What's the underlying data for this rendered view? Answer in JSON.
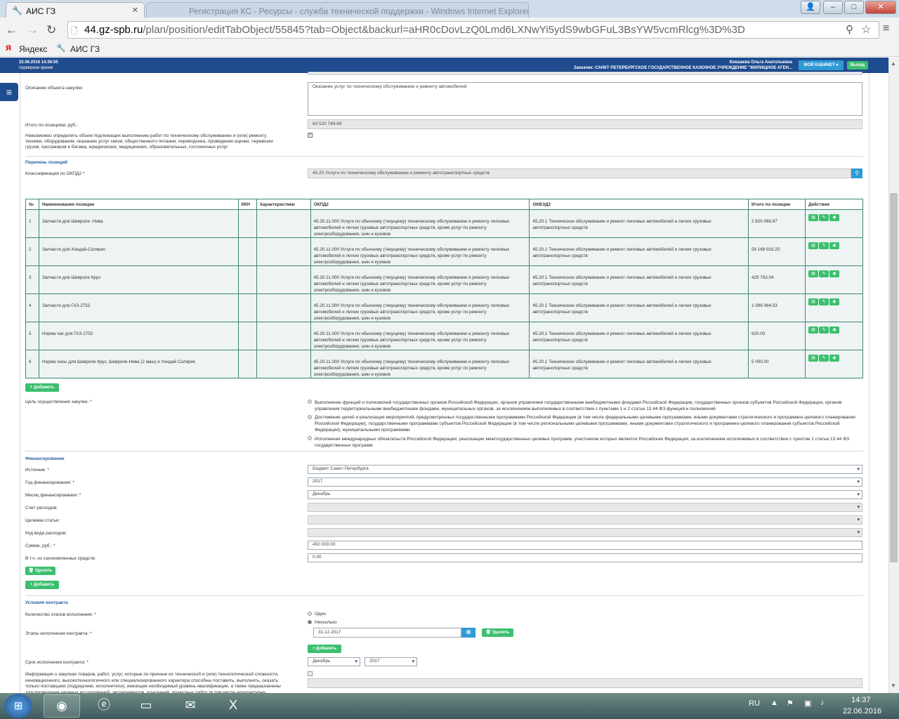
{
  "browser": {
    "tab_active": "АИС ГЗ",
    "tab_inactive": "Регистрация КС - Ресурсы - служба технической поддержки - Windows Internet Explorer",
    "url_host": "44.gz-spb.ru",
    "url_path": "/plan/position/editTabObject/55845?tab=Object&backurl=aHR0cDovLzQ0Lmd6LXNwYi5ydS9wbGFuL3BsYW5vcmRlcg%3D%3D",
    "bookmarks": [
      "Яндекс",
      "АИС ГЗ"
    ],
    "minimize": "–",
    "maximize": "□",
    "close": "✕",
    "newtab": "+"
  },
  "header": {
    "date": "22.06.2016 14:36:55",
    "time_label": "серверное время",
    "user": "Кокшаева Ольга Анатольевна",
    "customer": "Заказчик: САНКТ-ПЕТЕРБУРГСКОЕ ГОСУДАРСТВЕННОЕ КАЗЕННОЕ УЧРЕЖДЕНИЕ \"ЖИЛИЩНОЕ АГЕН...",
    "cabinet": "МОЙ КАБИНЕТ ▾",
    "exit": "Выход"
  },
  "form": {
    "desc_label": "Описание объекта закупки:",
    "desc_value": "Оказание услуг по техническому обслуживанию и ремонту автомобилей",
    "total_label": "Итого по позициям, руб.:",
    "total_value": "63 520 749,69",
    "impossible_label": "Невозможно определить объем подлежащих выполнению работ по техническому обслуживанию и (или) ремонту техники, оборудования, оказанию услуг связи, общественного питания, переводчика, проведения оценки, перевозки грузов, пассажиров и багажа, юридических, медицинских, образовательных, гостиничных услуг",
    "positions_title": "Перечень позиций",
    "okpd_label": "Классификация по ОКПД2 *",
    "okpd_value": "45.20 Услуги по техническому обслуживанию и ремонту автотранспортных средств",
    "add_label": "+ Добавить",
    "purpose_label": "Цель осуществления закупки: *",
    "purposes": [
      "Выполнение функций и полномочий государственных органов Российской Федерации, органов управления государственными внебюджетными фондами Российской Федерации, государственных органов субъектов Российской Федерации, органов управления территориальными внебюджетными фондами, муниципальных органов, за исключением выполняемых в соответствии с пунктами 1 и 2 статьи 13 44 ФЗ функций и полномочий",
      "Достижение целей и реализация мероприятий, предусмотренных государственными программами Российской Федерации (в том числе федеральными целевыми программами, иными документами стратегического и программно-целевого планирования Российской Федерации), государственными программами субъектов Российской Федерации (в том числе региональными целевыми программами, иными документами стратегического и программно-целевого планирования субъектов Российской Федерации), муниципальными программами",
      "Исполнение международных обязательств Российской Федерации, реализации межгосударственных целевых программ, участником которых является Российская Федерация, за исключением исполняемых в соответствии с пунктом 1 статьи 13 44 ФЗ государственных программ"
    ],
    "fin_title": "Финансирование",
    "fin": [
      {
        "label": "Источник: *",
        "value": "Бюджет Санкт-Петербурга"
      },
      {
        "label": "Год финансирования: *",
        "value": "2017"
      },
      {
        "label": "Месяц финансирования: *",
        "value": "Декабрь"
      },
      {
        "label": "Счет расходов:",
        "value": ""
      },
      {
        "label": "Целевая статья:",
        "value": ""
      },
      {
        "label": "Код вида расходов:",
        "value": ""
      }
    ],
    "sum_label": "Сумма, руб.: *",
    "sum_value": "450 000.00",
    "saved_label": "В т.ч. из сэкономленных средств:",
    "saved_value": "0.00",
    "delete_label": "🗑 Удалить",
    "contract_title": "Условия контракта",
    "stages_label": "Количество этапов исполнения: *",
    "stage_one": "Один",
    "stage_many": "Несколько",
    "stages_exec_label": "Этапы исполнения контракта: *",
    "stage_date": "31.12.2017",
    "term_label": "Срок исполнения контракта: *",
    "term_month": "Декабрь",
    "term_year": "2017",
    "info_label": "Информация о закупках товаров, работ, услуг, которые по причине их технической и (или) технологической сложности, инновационного, высокотехнологичного или специализированного характера способны поставить, выполнить, оказать только поставщики (подрядчики, исполнители), имеющие необходимый уровень квалификации, а также предназначены для проведения научных исследований, экспериментов, изысканий, проектных работ (в том числе архитектурно-строительного проектирования):"
  },
  "table": {
    "headers": [
      "№",
      "Наименование позиции",
      "ККН",
      "Характеристики",
      "ОКПД2",
      "ОКВЭД2",
      "Итого по позиции",
      "Действия"
    ],
    "rows": [
      {
        "n": "1",
        "name": "Запчасти для Шевроле -Нива",
        "okpd": "45.20.11.000 Услуги по обычному (текущему) техническому обслуживанию и ремонту легковых автомобилей и легких грузовых автотранспортных средств, кроме услуг по ремонту электрооборудования, шин и кузовов",
        "okved": "45.20.1 Техническое обслуживание и ремонт легковых автомобилей и легких грузовых автотранспортных средств",
        "total": "2 820 068.87"
      },
      {
        "n": "2",
        "name": "Запчасти для Хондай-Солярис",
        "okpd": "45.20.11.000 Услуги по обычному (текущему) техническому обслуживанию и ремонту легковых автомобилей и легких грузовых автотранспортных средств, кроме услуг по ремонту электрооборудования, шин и кузовов",
        "okved": "45.20.1 Техническое обслуживание и ремонт легковых автомобилей и легких грузовых автотранспортных средств",
        "total": "59 168 933.25"
      },
      {
        "n": "3",
        "name": "Запчасти для Шевроле Круз",
        "okpd": "45.20.11.000 Услуги по обычному (текущему) техническому обслуживанию и ремонту легковых автомобилей и легких грузовых автотранспортных средств, кроме услуг по ремонту электрооборудования, шин и кузовов",
        "okved": "45.20.1 Техническое обслуживание и ремонт легковых автомобилей и легких грузовых автотранспортных средств",
        "total": "429 763.04"
      },
      {
        "n": "4",
        "name": "Запчасти для ГАЗ-2752",
        "okpd": "45.20.11.000 Услуги по обычному (текущему) техническому обслуживанию и ремонту легковых автомобилей и легких грузовых автотранспортных средств, кроме услуг по ремонту электрооборудования, шин и кузовов",
        "okved": "45.20.1 Техническое обслуживание и ремонт легковых автомобилей и легких грузовых автотранспортных средств",
        "total": "1 096 064.53"
      },
      {
        "n": "5",
        "name": "Норма час для ГАЗ-2752",
        "okpd": "45.20.11.000 Услуги по обычному (текущему) техническому обслуживанию и ремонту легковых автомобилей и легких грузовых автотранспортных средств, кроме услуг по ремонту электрооборудования, шин и кузовов",
        "okved": "45.20.1 Техническое обслуживание и ремонт легковых автомобилей и легких грузовых автотранспортных средств",
        "total": "920.00"
      },
      {
        "n": "6",
        "name": "Норма часы для Шевроле Круз, Шевроле-Нива (2 маш) и Хондай Солярис",
        "okpd": "45.20.11.000 Услуги по обычному (текущему) техническому обслуживанию и ремонту легковых автомобилей и легких грузовых автотранспортных средств, кроме услуг по ремонту электрооборудования, шин и кузовов",
        "okved": "45.20.1 Техническое обслуживание и ремонт легковых автомобилей и легких грузовых автотранспортных средств",
        "total": "5 000.00"
      }
    ]
  },
  "taskbar": {
    "lang": "RU",
    "time": "14:37",
    "date": "22.06.2016"
  }
}
